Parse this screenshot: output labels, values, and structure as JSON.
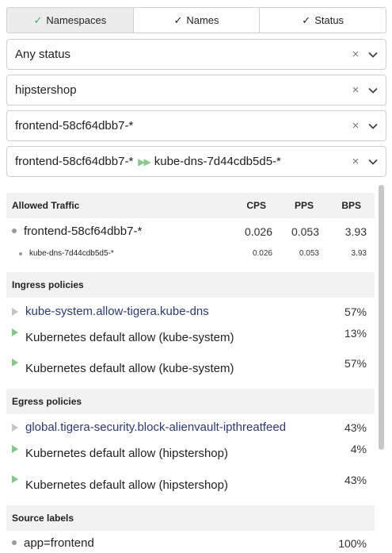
{
  "tabs": [
    {
      "label": "Namespaces",
      "active": true
    },
    {
      "label": "Names",
      "active": false
    },
    {
      "label": "Status",
      "active": false
    }
  ],
  "filters": {
    "status": "Any status",
    "namespace": "hipstershop",
    "name": "frontend-58cf64dbb7-*",
    "flow_source": "frontend-58cf64dbb7-*",
    "flow_arrows": "▶▶",
    "flow_destination": "kube-dns-7d44cdb5d5-*"
  },
  "icons": {
    "clear": "×",
    "check": "✓"
  },
  "colors": {
    "accent_green": "#3ea860",
    "link": "#2c3a78",
    "section_bg": "#f2f2f2"
  },
  "traffic": {
    "header": "Allowed Traffic",
    "columns": [
      "CPS",
      "PPS",
      "BPS"
    ],
    "rows": [
      {
        "name": "frontend-58cf64dbb7-*",
        "cps": "0.026",
        "pps": "0.053",
        "bps": "3.93"
      },
      {
        "name": "kube-dns-7d44cdb5d5-*",
        "cps": "0.026",
        "pps": "0.053",
        "bps": "3.93"
      }
    ]
  },
  "ingress": {
    "header": "Ingress policies",
    "items": [
      {
        "name": "kube-system.allow-tigera.kube-dns",
        "percent": "57%"
      },
      {
        "name": "Kubernetes default allow (kube-system)",
        "percent": "13%"
      },
      {
        "name": "Kubernetes default allow (kube-system)",
        "percent": "57%"
      }
    ]
  },
  "egress": {
    "header": "Egress policies",
    "items": [
      {
        "name": "global.tigera-security.block-alienvault-ipthreatfeed",
        "percent": "43%"
      },
      {
        "name": "Kubernetes default allow (hipstershop)",
        "percent": "4%"
      },
      {
        "name": "Kubernetes default allow (hipstershop)",
        "percent": "43%"
      }
    ]
  },
  "source_labels": {
    "header": "Source labels",
    "items": [
      {
        "label": "app=frontend",
        "percent": "100%"
      }
    ]
  }
}
